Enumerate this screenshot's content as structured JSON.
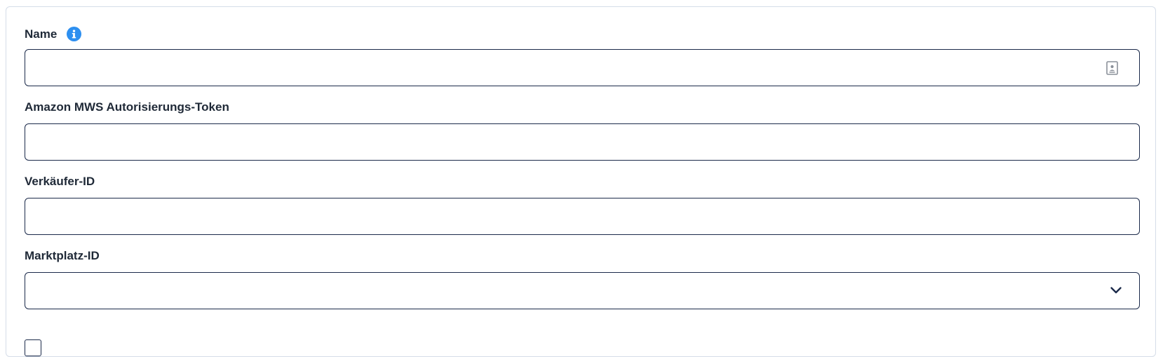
{
  "form": {
    "fields": [
      {
        "label": "Name",
        "value": "",
        "placeholder": ""
      },
      {
        "label": "Amazon MWS Autorisierungs-Token",
        "value": "",
        "placeholder": ""
      },
      {
        "label": "Verkäufer-ID",
        "value": "",
        "placeholder": ""
      },
      {
        "label": "Marktplatz-ID",
        "selected": ""
      }
    ]
  },
  "icons": {
    "info": "info-icon",
    "contact": "contact-card-icon",
    "dropdown": "chevron-down-icon"
  },
  "colors": {
    "info_blue": "#2d8ff0",
    "border_dark": "#1b2a4a",
    "label_text": "#1f2937"
  }
}
